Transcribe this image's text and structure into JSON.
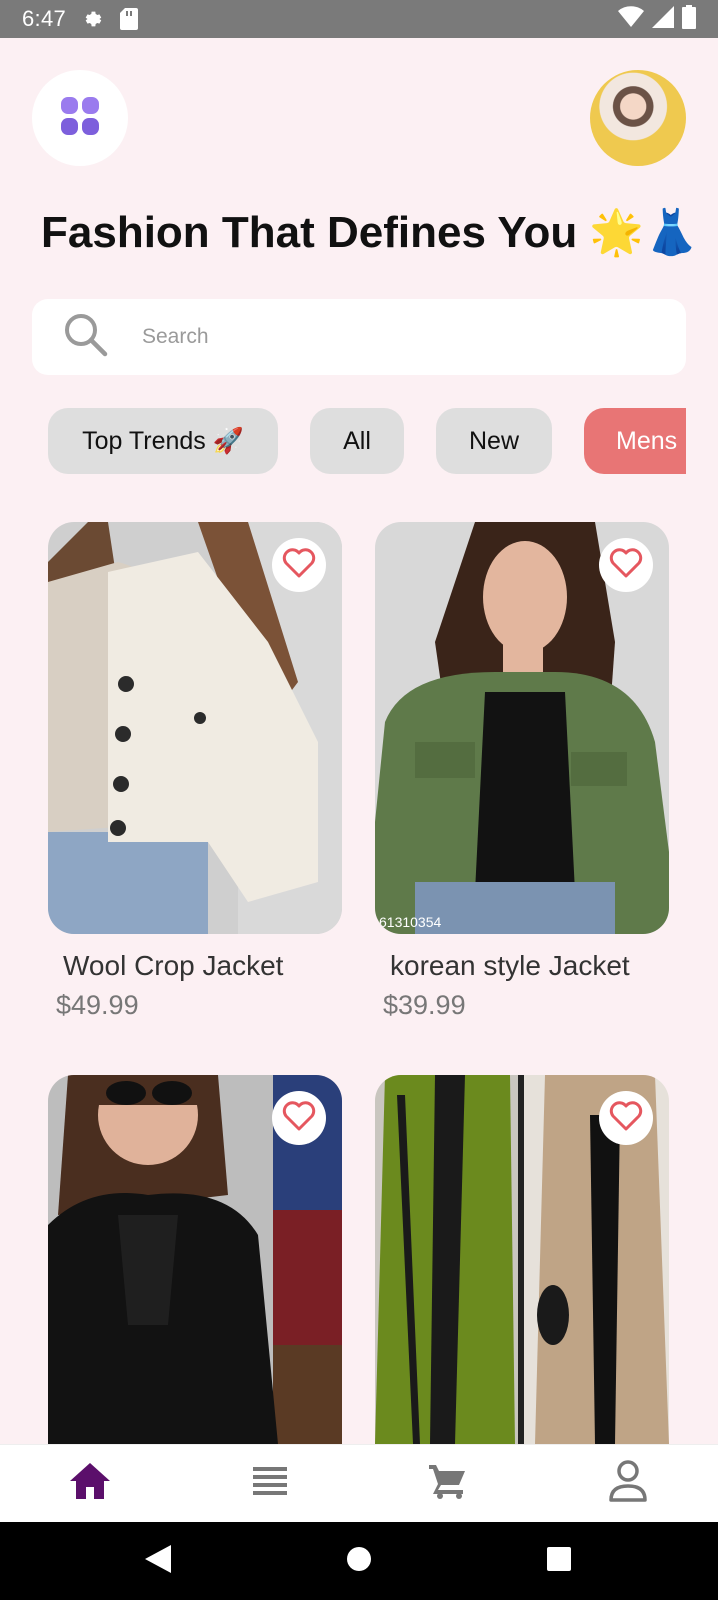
{
  "status_bar": {
    "time": "6:47",
    "icons": [
      "gear-icon",
      "sd-card-icon",
      "wifi-icon",
      "signal-icon",
      "battery-icon"
    ]
  },
  "header": {
    "menu_icon": "grid-menu-icon",
    "title": "Fashion That Defines You 🌟👗"
  },
  "search": {
    "placeholder": "Search",
    "value": ""
  },
  "categories": [
    {
      "label": "Top Trends 🚀",
      "active": false
    },
    {
      "label": "All",
      "active": false
    },
    {
      "label": "New",
      "active": false
    },
    {
      "label": "Mens",
      "active": true
    }
  ],
  "products": [
    {
      "name": "Wool Crop Jacket",
      "price": "$49.99",
      "watermark": ""
    },
    {
      "name": "korean style Jacket",
      "price": "$39.99",
      "watermark": "61310354"
    },
    {
      "name": "",
      "price": ""
    },
    {
      "name": "",
      "price": ""
    }
  ],
  "bottom_nav": [
    {
      "icon": "home-icon",
      "active": true
    },
    {
      "icon": "list-icon",
      "active": false
    },
    {
      "icon": "cart-icon",
      "active": false
    },
    {
      "icon": "profile-icon",
      "active": false
    }
  ],
  "colors": {
    "background": "#fcf0f3",
    "accent_active_chip": "#e87575",
    "nav_active": "#5b0f6b",
    "heart": "#e5575f",
    "menu_icon": "#8f6fe6"
  }
}
